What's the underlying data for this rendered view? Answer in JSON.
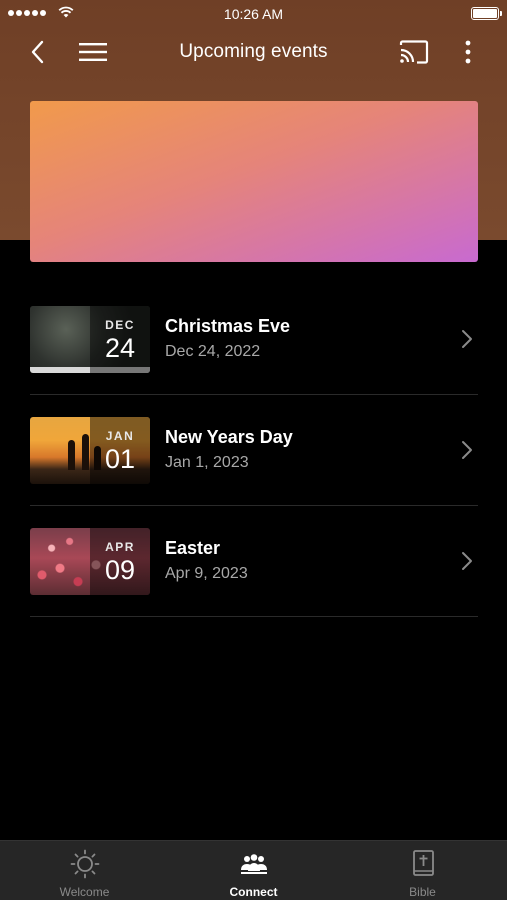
{
  "status_bar": {
    "time": "10:26 AM"
  },
  "nav": {
    "title": "Upcoming events"
  },
  "events": [
    {
      "month": "DEC",
      "day": "24",
      "title": "Christmas Eve",
      "date": "Dec 24, 2022"
    },
    {
      "month": "JAN",
      "day": "01",
      "title": "New Years Day",
      "date": "Jan 1, 2023"
    },
    {
      "month": "APR",
      "day": "09",
      "title": "Easter",
      "date": "Apr 9, 2023"
    }
  ],
  "tabs": [
    {
      "label": "Welcome",
      "icon": "sun-icon",
      "active": false
    },
    {
      "label": "Connect",
      "icon": "people-icon",
      "active": true
    },
    {
      "label": "Bible",
      "icon": "bible-icon",
      "active": false
    }
  ],
  "colors": {
    "header_bg": "#7a4a2e",
    "banner_gradient_start": "#f19a4b",
    "banner_gradient_end": "#c86ad0",
    "tabbar_bg": "#262626"
  }
}
